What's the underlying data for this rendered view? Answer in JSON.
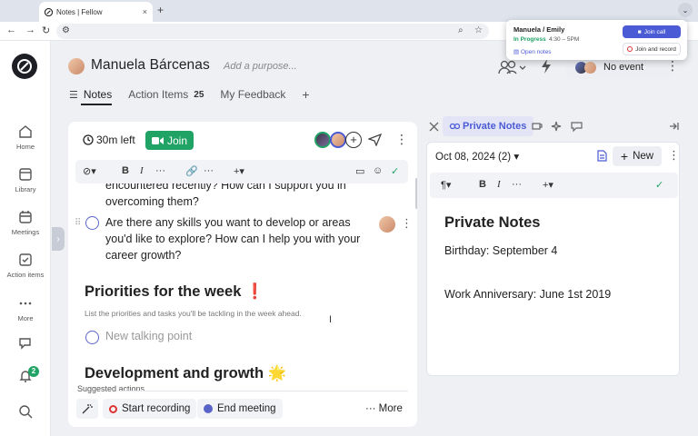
{
  "browser": {
    "tab_title": "Notes | Fellow",
    "tab_close": "×",
    "new_tab": "+",
    "tab_dropdown": "⌄"
  },
  "popup": {
    "meeting": "Manuela / Emily",
    "status": "In Progress",
    "time": "4:30 – 5PM",
    "open_notes": "Open notes",
    "join_call": "Join call",
    "join_and_record": "Join and record"
  },
  "rail": {
    "items": [
      {
        "label": "Home"
      },
      {
        "label": "Library"
      },
      {
        "label": "Meetings"
      },
      {
        "label": "Action items"
      },
      {
        "label": "More"
      }
    ],
    "notifications_count": "2"
  },
  "header": {
    "name": "Manuela Bárcenas",
    "purpose_placeholder": "Add a purpose...",
    "tabs": [
      {
        "label": "Notes"
      },
      {
        "label": "Action Items",
        "count": "25"
      },
      {
        "label": "My Feedback"
      }
    ],
    "add_tab": "+",
    "event": "No event"
  },
  "notes": {
    "time_left": "30m left",
    "join": "Join",
    "prev_text": [
      "encountered recently? How can I support you in",
      "overcoming them?"
    ],
    "item_text": [
      "Are there any skills you want to develop or areas",
      "you'd like to explore? How can I help you with your",
      "career growth?"
    ],
    "section1_title": "Priorities for the week",
    "section1_emoji": "❗",
    "section1_hint": "List the priorities and tasks you'll be tackling in the week ahead.",
    "new_point_placeholder": "New talking point",
    "section2_title": "Development and growth",
    "section2_emoji": "🌟",
    "suggested_label": "Suggested actions",
    "start_recording": "Start recording",
    "end_meeting": "End meeting",
    "more": "··· More"
  },
  "private": {
    "label": "Private Notes",
    "date": "Oct 08, 2024 (2)",
    "new": "New",
    "title": "Private Notes",
    "lines": [
      "Birthday: September 4",
      "Work Anniversary: June 1st 2019"
    ]
  },
  "colors": {
    "accent": "#4b5bd6",
    "green": "#21a366",
    "record_red": "#d33333"
  }
}
